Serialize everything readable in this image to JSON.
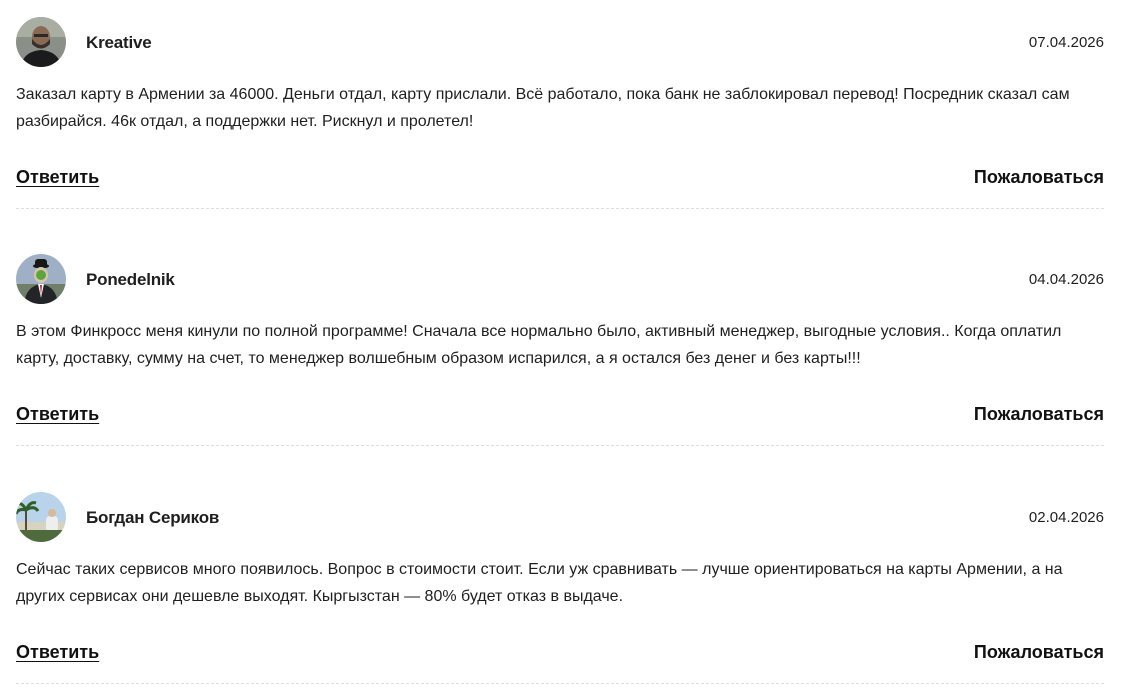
{
  "comments": [
    {
      "author": "Kreative",
      "date": "07.04.2026",
      "text": "Заказал карту в Армении за 46000. Деньги отдал, карту прислали. Всё работало, пока банк не заблокировал перевод! Посредник сказал сам разбирайся. 46к отдал, а поддержки нет. Рискнул и пролетел!",
      "avatar_icon": "user-photo-man-avatar",
      "reply_label": "Ответить",
      "report_label": "Пожаловаться"
    },
    {
      "author": "Ponedelnik",
      "date": "04.04.2026",
      "text": "В этом Финкросс меня кинули по полной программе! Сначала все нормально было, активный менеджер, выгодные условия.. Когда оплатил карту, доставку, сумму на счет, то менеджер волшебным образом испарился, а я остался без денег и без карты!!!",
      "avatar_icon": "magritte-bowler-hat-avatar",
      "reply_label": "Ответить",
      "report_label": "Пожаловаться"
    },
    {
      "author": "Богдан Сериков",
      "date": "02.04.2026",
      "text": "Сейчас таких сервисов много появилось. Вопрос в стоимости стоит. Если уж сравнивать — лучше ориентироваться на карты Армении, а на других сервисах они дешевле выходят. Кыргызстан — 80% будет отказ в выдаче.",
      "avatar_icon": "palm-beach-avatar",
      "reply_label": "Ответить",
      "report_label": "Пожаловаться"
    }
  ]
}
